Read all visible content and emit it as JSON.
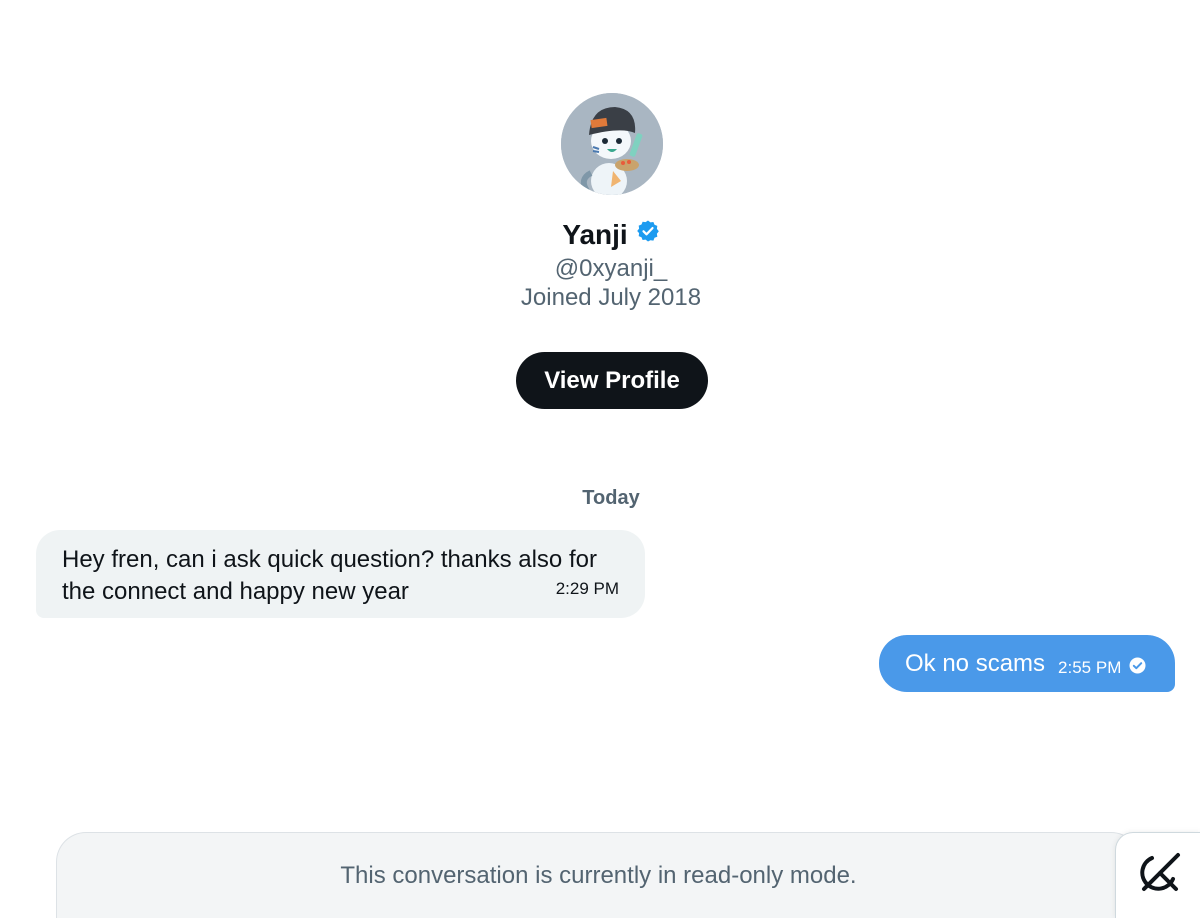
{
  "profile": {
    "name": "Yanji",
    "handle": "@0xyanji_",
    "joined": "Joined July 2018",
    "view_profile_label": "View Profile",
    "verified_color": "#1d9bf0"
  },
  "conversation": {
    "date_label": "Today",
    "messages": [
      {
        "direction": "incoming",
        "text": "Hey fren, can i ask quick question? thanks also for the connect and happy new year",
        "time": "2:29 PM"
      },
      {
        "direction": "outgoing",
        "text": "Ok no scams",
        "time": "2:55 PM",
        "status": "sent-check-icon"
      }
    ]
  },
  "footer": {
    "readonly_text": "This conversation is currently in read-only mode.",
    "grok_icon": "grok-icon"
  },
  "colors": {
    "outgoing_bubble": "#4a99e9",
    "incoming_bubble": "#eff3f4",
    "primary_button": "#0f1419",
    "secondary_text": "#536471"
  }
}
